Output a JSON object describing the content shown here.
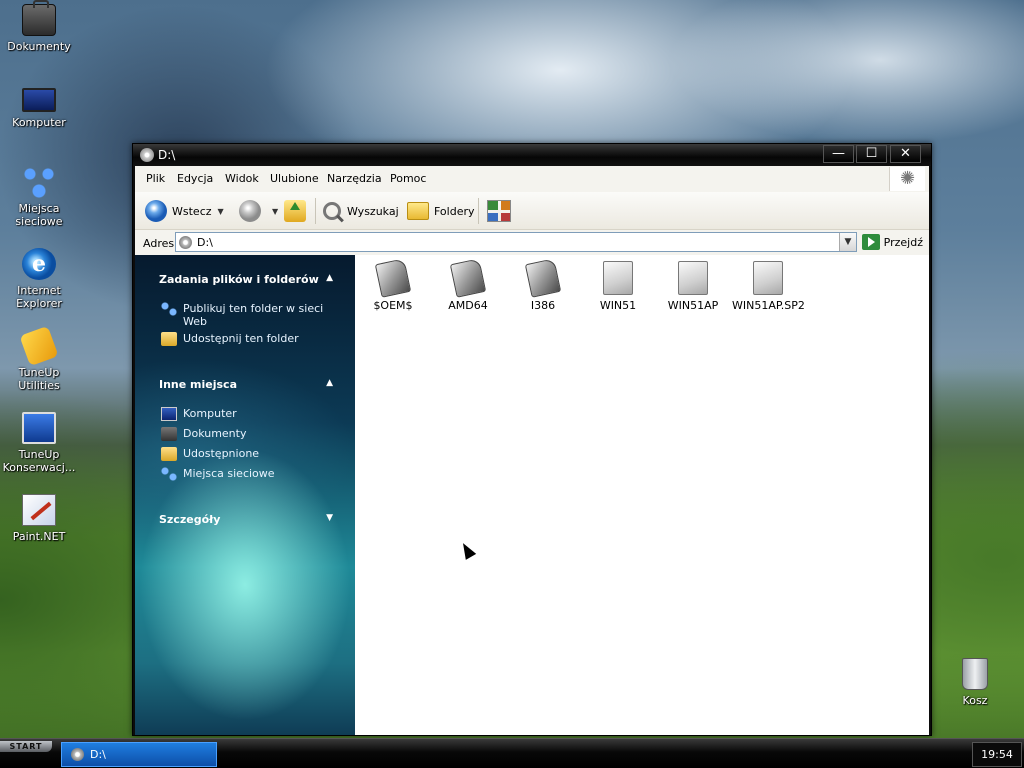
{
  "desktop": {
    "icons": [
      {
        "label": "Dokumenty",
        "icon": "briefcase-icon"
      },
      {
        "label": "Komputer",
        "icon": "computer-icon"
      },
      {
        "label": "Miejsca sieciowe",
        "icon": "network-icon"
      },
      {
        "label": "Internet Explorer",
        "icon": "ie-icon"
      },
      {
        "label": "TuneUp Utilities",
        "icon": "tuneup-icon"
      },
      {
        "label": "TuneUp Konserwacj...",
        "icon": "tuneup-maintenance-icon"
      },
      {
        "label": "Paint.NET",
        "icon": "paint-icon"
      },
      {
        "label": "Kosz",
        "icon": "recycle-bin-icon"
      }
    ]
  },
  "window": {
    "title": "D:\\",
    "buttons": {
      "minimize": "—",
      "maximize": "☐",
      "close": "✕"
    },
    "menu": [
      "Plik",
      "Edycja",
      "Widok",
      "Ulubione",
      "Narzędzia",
      "Pomoc"
    ],
    "toolbar": {
      "back": "Wstecz",
      "search": "Wyszukaj",
      "folders": "Foldery"
    },
    "address": {
      "label": "Adres",
      "value": "D:\\",
      "go": "Przejdź"
    }
  },
  "taskpane": {
    "file_tasks": {
      "title": "Zadania plików i folderów",
      "items": [
        "Publikuj ten folder w sieci Web",
        "Udostępnij ten folder"
      ]
    },
    "other_places": {
      "title": "Inne miejsca",
      "items": [
        "Komputer",
        "Dokumenty",
        "Udostępnione",
        "Miejsca sieciowe"
      ]
    },
    "details": {
      "title": "Szczegóły"
    }
  },
  "files": [
    {
      "name": "$OEM$",
      "type": "hidden-folder"
    },
    {
      "name": "AMD64",
      "type": "hidden-folder"
    },
    {
      "name": "I386",
      "type": "hidden-folder"
    },
    {
      "name": "WIN51",
      "type": "file"
    },
    {
      "name": "WIN51AP",
      "type": "file"
    },
    {
      "name": "WIN51AP.SP2",
      "type": "file"
    }
  ],
  "taskbar": {
    "start": "START",
    "task": "D:\\",
    "clock": "19:54"
  }
}
